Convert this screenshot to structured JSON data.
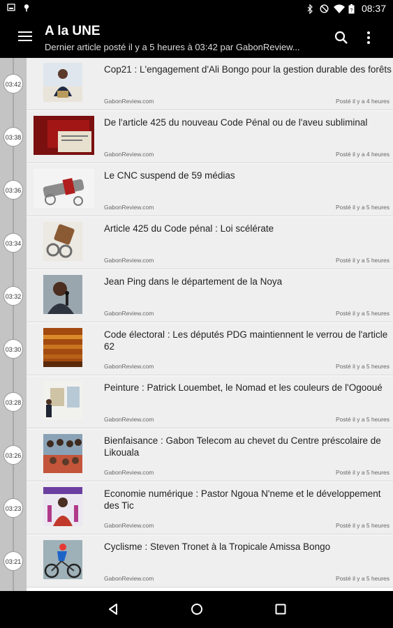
{
  "status_bar": {
    "time": "08:37",
    "left_icons": [
      "notification-icon",
      "location-icon"
    ],
    "right_icons": [
      "bluetooth-icon",
      "do-not-disturb-icon",
      "wifi-icon",
      "battery-icon"
    ]
  },
  "app_bar": {
    "title": "A la UNE",
    "subtitle": "Dernier article posté il y a 5 heures à 03:42 par GabonReview..."
  },
  "articles": [
    {
      "time": "03:42",
      "title": "Cop21 : L'engagement d'Ali Bongo pour la gestion durable des forêts",
      "source": "GabonReview.com",
      "posted": "Posté il y a 4 heures"
    },
    {
      "time": "03:38",
      "title": "De l'article 425 du nouveau Code Pénal ou de l'aveu subliminal",
      "source": "GabonReview.com",
      "posted": "Posté il y a 4 heures"
    },
    {
      "time": "03:36",
      "title": "Le CNC suspend de 59 médias",
      "source": "GabonReview.com",
      "posted": "Posté il y a 5 heures"
    },
    {
      "time": "03:34",
      "title": "Article 425 du Code pénal : Loi scélérate",
      "source": "GabonReview.com",
      "posted": "Posté il y a 5 heures"
    },
    {
      "time": "03:32",
      "title": "Jean Ping dans le département de la Noya",
      "source": "GabonReview.com",
      "posted": "Posté il y a 5 heures"
    },
    {
      "time": "03:30",
      "title": "Code électoral : Les députés PDG maintiennent le verrou de l'article 62",
      "source": "GabonReview.com",
      "posted": "Posté il y a 5 heures"
    },
    {
      "time": "03:28",
      "title": "Peinture : Patrick Louembet, le Nomad et les couleurs de l'Ogooué",
      "source": "GabonReview.com",
      "posted": "Posté il y a 5 heures"
    },
    {
      "time": "03:26",
      "title": "Bienfaisance : Gabon Telecom au chevet du Centre préscolaire de Likouala",
      "source": "GabonReview.com",
      "posted": "Posté il y a 5 heures"
    },
    {
      "time": "03:23",
      "title": "Economie numérique : Pastor Ngoua N'neme et le développement des Tic",
      "source": "GabonReview.com",
      "posted": "Posté il y a 5 heures"
    },
    {
      "time": "03:21",
      "title": "Cyclisme : Steven Tronet à la Tropicale Amissa Bongo",
      "source": "GabonReview.com",
      "posted": "Posté il y a 5 heures"
    }
  ]
}
